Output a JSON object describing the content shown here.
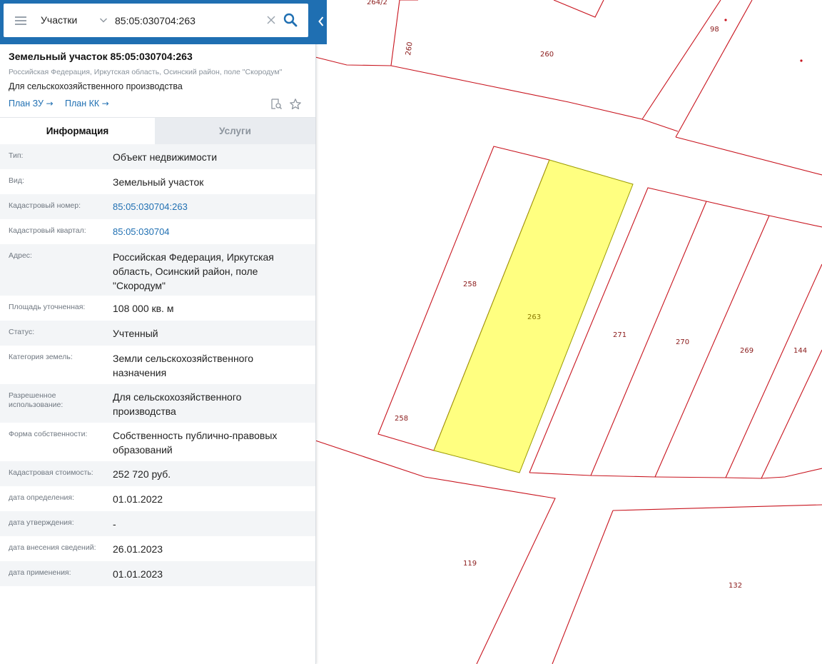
{
  "search": {
    "type_label": "Участки",
    "query": "85:05:030704:263"
  },
  "card": {
    "title": "Земельный участок 85:05:030704:263",
    "address": "Российская Федерация, Иркутская область, Осинский район, поле \"Скородум\"",
    "usage": "Для сельскохозяйственного производства",
    "plan_zu_label": "План ЗУ",
    "plan_kk_label": "План КК",
    "link_arrow": "→"
  },
  "tabs": {
    "info": "Информация",
    "services": "Услуги"
  },
  "properties": [
    {
      "label": "Тип:",
      "value": "Объект недвижимости"
    },
    {
      "label": "Вид:",
      "value": "Земельный участок"
    },
    {
      "label": "Кадастровый номер:",
      "value": "85:05:030704:263"
    },
    {
      "label": "Кадастровый квартал:",
      "value": "85:05:030704"
    },
    {
      "label": "Адрес:",
      "value": "Российская Федерация, Иркутская область, Осинский район, поле \"Скородум\""
    },
    {
      "label": "Площадь уточненная:",
      "value": "108 000 кв. м"
    },
    {
      "label": "Статус:",
      "value": "Учтенный"
    },
    {
      "label": "Категория земель:",
      "value": "Земли сельскохозяйственного назначения"
    },
    {
      "label": "Разрешенное использование:",
      "value": "Для сельскохозяйственного производства"
    },
    {
      "label": "Форма собственности:",
      "value": "Собственность публично-правовых образований"
    },
    {
      "label": "Кадастровая стоимость:",
      "value": "252 720 руб."
    },
    {
      "label": "дата определения:",
      "value": "01.01.2022"
    },
    {
      "label": "дата утверждения:",
      "value": "-"
    },
    {
      "label": "дата внесения сведений:",
      "value": "26.01.2023"
    },
    {
      "label": "дата применения:",
      "value": "01.01.2023"
    }
  ],
  "map": {
    "parcel_labels": [
      "264/2",
      "260",
      "260",
      "98",
      "258",
      "263",
      "271",
      "270",
      "269",
      "144",
      "258",
      "119",
      "132"
    ]
  },
  "colors": {
    "header_blue": "#1f6fb2",
    "parcel_border": "#c8141e",
    "selected_fill": "#ffff80",
    "link": "#1f6fb2"
  }
}
